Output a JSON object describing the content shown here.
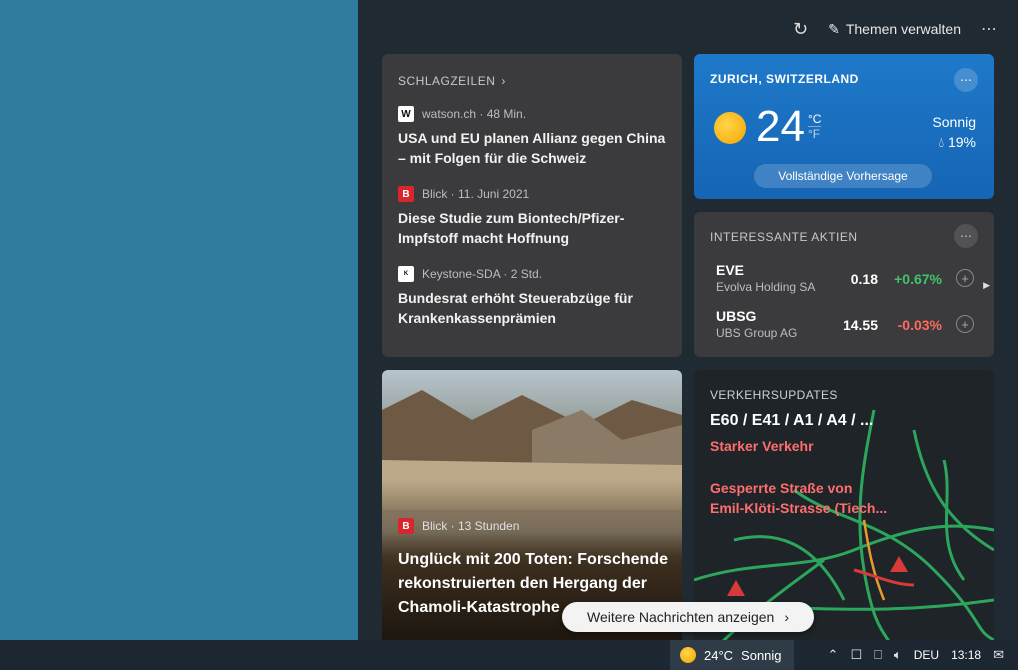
{
  "toolbar": {
    "manage_label": "Themen verwalten"
  },
  "headlines": {
    "title": "SCHLAGZEILEN",
    "items": [
      {
        "logo": "W",
        "source": "watson.ch · 48 Min.",
        "title": "USA und EU planen Allianz gegen China – mit Folgen für die Schweiz"
      },
      {
        "logo": "B",
        "source": "Blick · 11. Juni 2021",
        "title": "Diese Studie zum Biontech/Pfizer-Impfstoff macht Hoffnung"
      },
      {
        "logo": "K",
        "source": "Keystone-SDA · 2 Std.",
        "title": "Bundesrat erhöht Steuerabzüge für Krankenkassenprämien"
      }
    ]
  },
  "weather": {
    "location": "ZURICH, SWITZERLAND",
    "temperature": "24",
    "unit_c": "°C",
    "unit_f": "°F",
    "condition": "Sonnig",
    "precip": "19%",
    "forecast_label": "Vollständige Vorhersage"
  },
  "stocks": {
    "title": "INTERESSANTE AKTIEN",
    "items": [
      {
        "symbol": "EVE",
        "name": "Evolva Holding SA",
        "price": "0.18",
        "change": "+0.67%"
      },
      {
        "symbol": "UBSG",
        "name": "UBS Group AG",
        "price": "14.55",
        "change": "-0.03%"
      }
    ]
  },
  "feature": {
    "logo": "B",
    "source": "Blick · 13 Stunden",
    "title": "Unglück mit 200 Toten: Forschende rekonstruierten den Hergang der Chamoli-Katastrophe"
  },
  "traffic": {
    "title": "VERKEHRSUPDATES",
    "road": "E60 / E41 / A1 / A4 / ...",
    "status": "Starker Verkehr",
    "closure": "Gesperrte Straße von Emil-Klöti-Strasse (Tiech..."
  },
  "more_news_label": "Weitere Nachrichten anzeigen",
  "taskbar": {
    "weather_temp": "24°C",
    "weather_cond": "Sonnig",
    "language": "DEU",
    "time": "13:18"
  },
  "colors": {
    "positive": "#3fc46b",
    "negative": "#ff6a5c",
    "weather_bg": "#1f79c9"
  }
}
